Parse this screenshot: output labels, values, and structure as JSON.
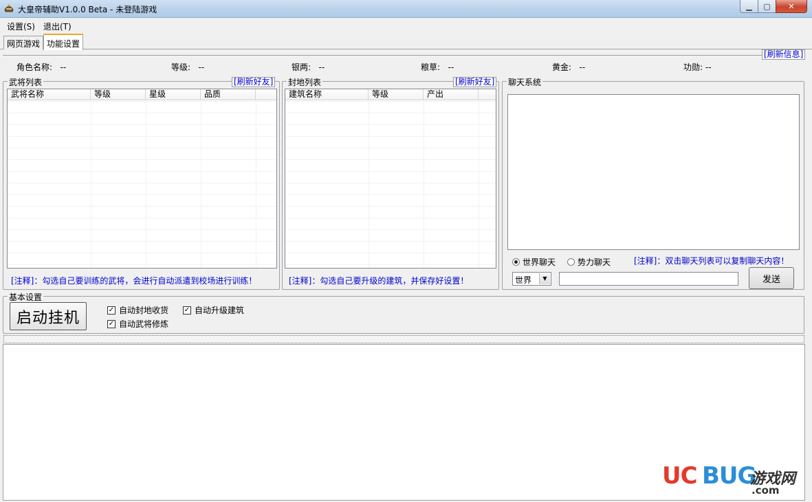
{
  "window": {
    "title": "大皇帝辅助V1.0.0 Beta - 未登陆游戏"
  },
  "menu": {
    "items": [
      "设置(S)",
      "退出(T)"
    ]
  },
  "tabs": [
    "网页游戏",
    "功能设置"
  ],
  "info": {
    "refresh_label": "[刷新信息]",
    "fields": [
      {
        "label": "角色名称:",
        "value": "--"
      },
      {
        "label": "等级:",
        "value": "--"
      },
      {
        "label": "银两:",
        "value": "--"
      },
      {
        "label": "粮草:",
        "value": "--"
      },
      {
        "label": "黄金:",
        "value": "--"
      },
      {
        "label": "功勋:",
        "value": "--"
      }
    ]
  },
  "generals": {
    "title": "武将列表",
    "refresh_label": "[刷新好友]",
    "columns": [
      "武将名称",
      "等级",
      "星级",
      "品质"
    ],
    "note": "[注释]：勾选自己要训练的武将，会进行自动派遣到校场进行训练！"
  },
  "fiefs": {
    "title": "封地列表",
    "refresh_label": "[刷新好友]",
    "columns": [
      "建筑名称",
      "等级",
      "产出"
    ],
    "note": "[注释]：勾选自己要升级的建筑，并保存好设置！"
  },
  "chat": {
    "title": "聊天系统",
    "radio_world": "世界聊天",
    "radio_faction": "势力聊天",
    "note": "[注释]：双击聊天列表可以复制聊天内容！",
    "channel_selected": "世界",
    "send_label": "发送"
  },
  "basic": {
    "title": "基本设置",
    "start_label": "启动挂机",
    "checkboxes": [
      "自动封地收货",
      "自动升级建筑",
      "自动武将修炼"
    ]
  },
  "watermark": {
    "uc": "UC",
    "bug": "BUG",
    "cn": "游戏网",
    "domain": ".com"
  },
  "colors": {
    "link": "#0000cc",
    "accent_tab": "#f5a623",
    "watermark_red": "#e43a2b",
    "watermark_blue": "#2a8ed8"
  }
}
